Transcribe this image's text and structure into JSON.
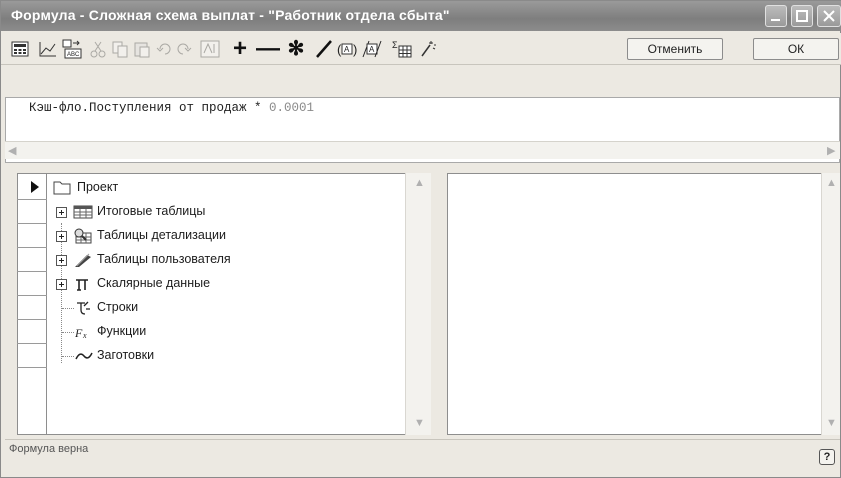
{
  "window": {
    "title": "Формула - Сложная схема выплат - \"Работник отдела сбыта\""
  },
  "toolbar": {
    "cancel_label": "Отменить",
    "ok_label": "ОК",
    "operators": {
      "plus": "+",
      "minus": "—",
      "multiply": "✻",
      "divide": "/"
    },
    "icons": [
      "calculator-icon",
      "chart-icon",
      "text-abc-icon",
      "cut-icon",
      "copy-icon",
      "paste-icon",
      "undo-icon",
      "redo-icon",
      "function-icon",
      "plus-icon",
      "minus-icon",
      "multiply-icon",
      "divide-icon",
      "parentheses-a-icon",
      "parentheses-b-icon",
      "table-sum-icon",
      "wand-icon"
    ]
  },
  "formula": {
    "expression": "Кэш-фло.Поступления от продаж * ",
    "factor": "0.0001"
  },
  "tree": {
    "root": "Проект",
    "items": [
      {
        "label": "Итоговые таблицы",
        "icon": "table-icon",
        "expandable": true
      },
      {
        "label": "Таблицы детализации",
        "icon": "detail-table-icon",
        "expandable": true
      },
      {
        "label": "Таблицы пользователя",
        "icon": "user-table-icon",
        "expandable": true
      },
      {
        "label": "Скалярные данные",
        "icon": "pi-icon",
        "expandable": true
      },
      {
        "label": "Строки",
        "icon": "strings-icon",
        "expandable": false
      },
      {
        "label": "Функции",
        "icon": "function-fx-icon",
        "expandable": false
      },
      {
        "label": "Заготовки",
        "icon": "template-icon",
        "expandable": false
      }
    ]
  },
  "status": {
    "text": "Формула верна",
    "help": "?"
  }
}
